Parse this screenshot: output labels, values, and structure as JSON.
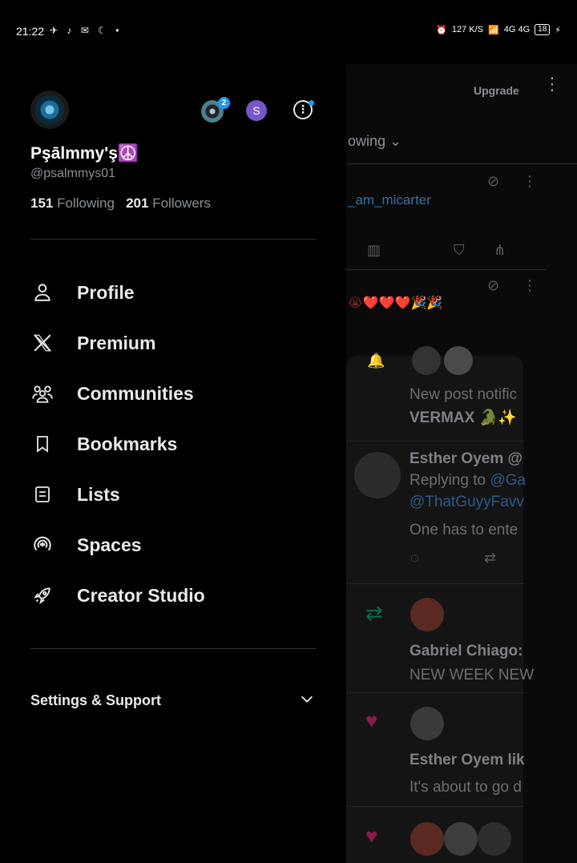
{
  "status_bar": {
    "time": "21:22",
    "left_icons": "✈ ♪ ✉ ☾ •",
    "network": "4G 4G",
    "speed": "127 K/S",
    "battery": "18"
  },
  "background": {
    "upgrade_label": "Upgrade",
    "tab_label": "owing",
    "handle_text": "_am_micarter",
    "emoji_text": "😭❤️❤️❤️🎉🎉",
    "notif_line1": "New post notific",
    "notif_line2": "VERMAX 🐊✨",
    "reply_author": "Esther Oyem @",
    "reply_to_prefix": "Replying to ",
    "reply_to_handle": "@Ga",
    "reply_to_handle2": "@ThatGuyyFavv",
    "reply_text": "One has to ente",
    "retweet_author": "Gabriel Chiago:",
    "retweet_text": "NEW WEEK NEW",
    "like_author": "Esther Oyem lik",
    "like_text": "It's about to go d"
  },
  "account": {
    "display_name": "Pşālmmy'ş☮️",
    "handle": "@psalmmys01",
    "following_count": "151",
    "following_label": "Following",
    "followers_count": "201",
    "followers_label": "Followers",
    "switch_badge": "2",
    "switch_initial": "S"
  },
  "menu": [
    {
      "label": "Profile",
      "icon": "person-icon"
    },
    {
      "label": "Premium",
      "icon": "x-logo-icon"
    },
    {
      "label": "Communities",
      "icon": "communities-icon"
    },
    {
      "label": "Bookmarks",
      "icon": "bookmark-icon"
    },
    {
      "label": "Lists",
      "icon": "list-icon"
    },
    {
      "label": "Spaces",
      "icon": "spaces-icon"
    },
    {
      "label": "Creator Studio",
      "icon": "rocket-icon"
    }
  ],
  "settings": {
    "label": "Settings & Support"
  },
  "colors": {
    "accent": "#1d9bf0",
    "background": "#000000",
    "text": "#e7e9ea",
    "muted": "#8b9096"
  }
}
